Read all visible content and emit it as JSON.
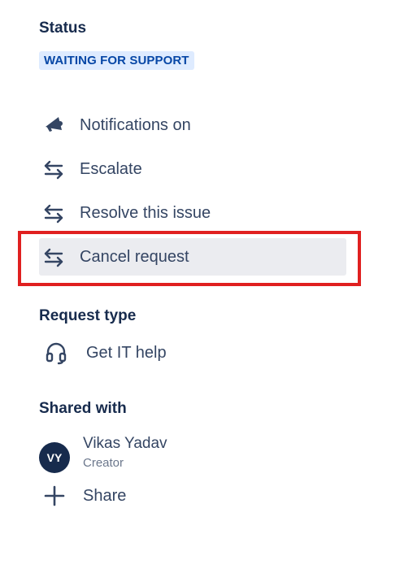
{
  "status": {
    "title": "Status",
    "badge": "WAITING FOR SUPPORT"
  },
  "actions": [
    {
      "label": "Notifications on",
      "icon": "megaphone-icon"
    },
    {
      "label": "Escalate",
      "icon": "transition-arrows-icon"
    },
    {
      "label": "Resolve this issue",
      "icon": "transition-arrows-icon"
    },
    {
      "label": "Cancel request",
      "icon": "transition-arrows-icon"
    }
  ],
  "request_type": {
    "title": "Request type",
    "value": "Get IT help",
    "icon": "headset-icon"
  },
  "shared_with": {
    "title": "Shared with",
    "user": {
      "initials": "VY",
      "name": "Vikas Yadav",
      "role": "Creator"
    },
    "share_label": "Share",
    "share_icon": "plus-icon"
  },
  "colors": {
    "badge_bg": "#deebff",
    "badge_text": "#0747a6",
    "highlight": "#e02020",
    "avatar_bg": "#172b4d"
  }
}
